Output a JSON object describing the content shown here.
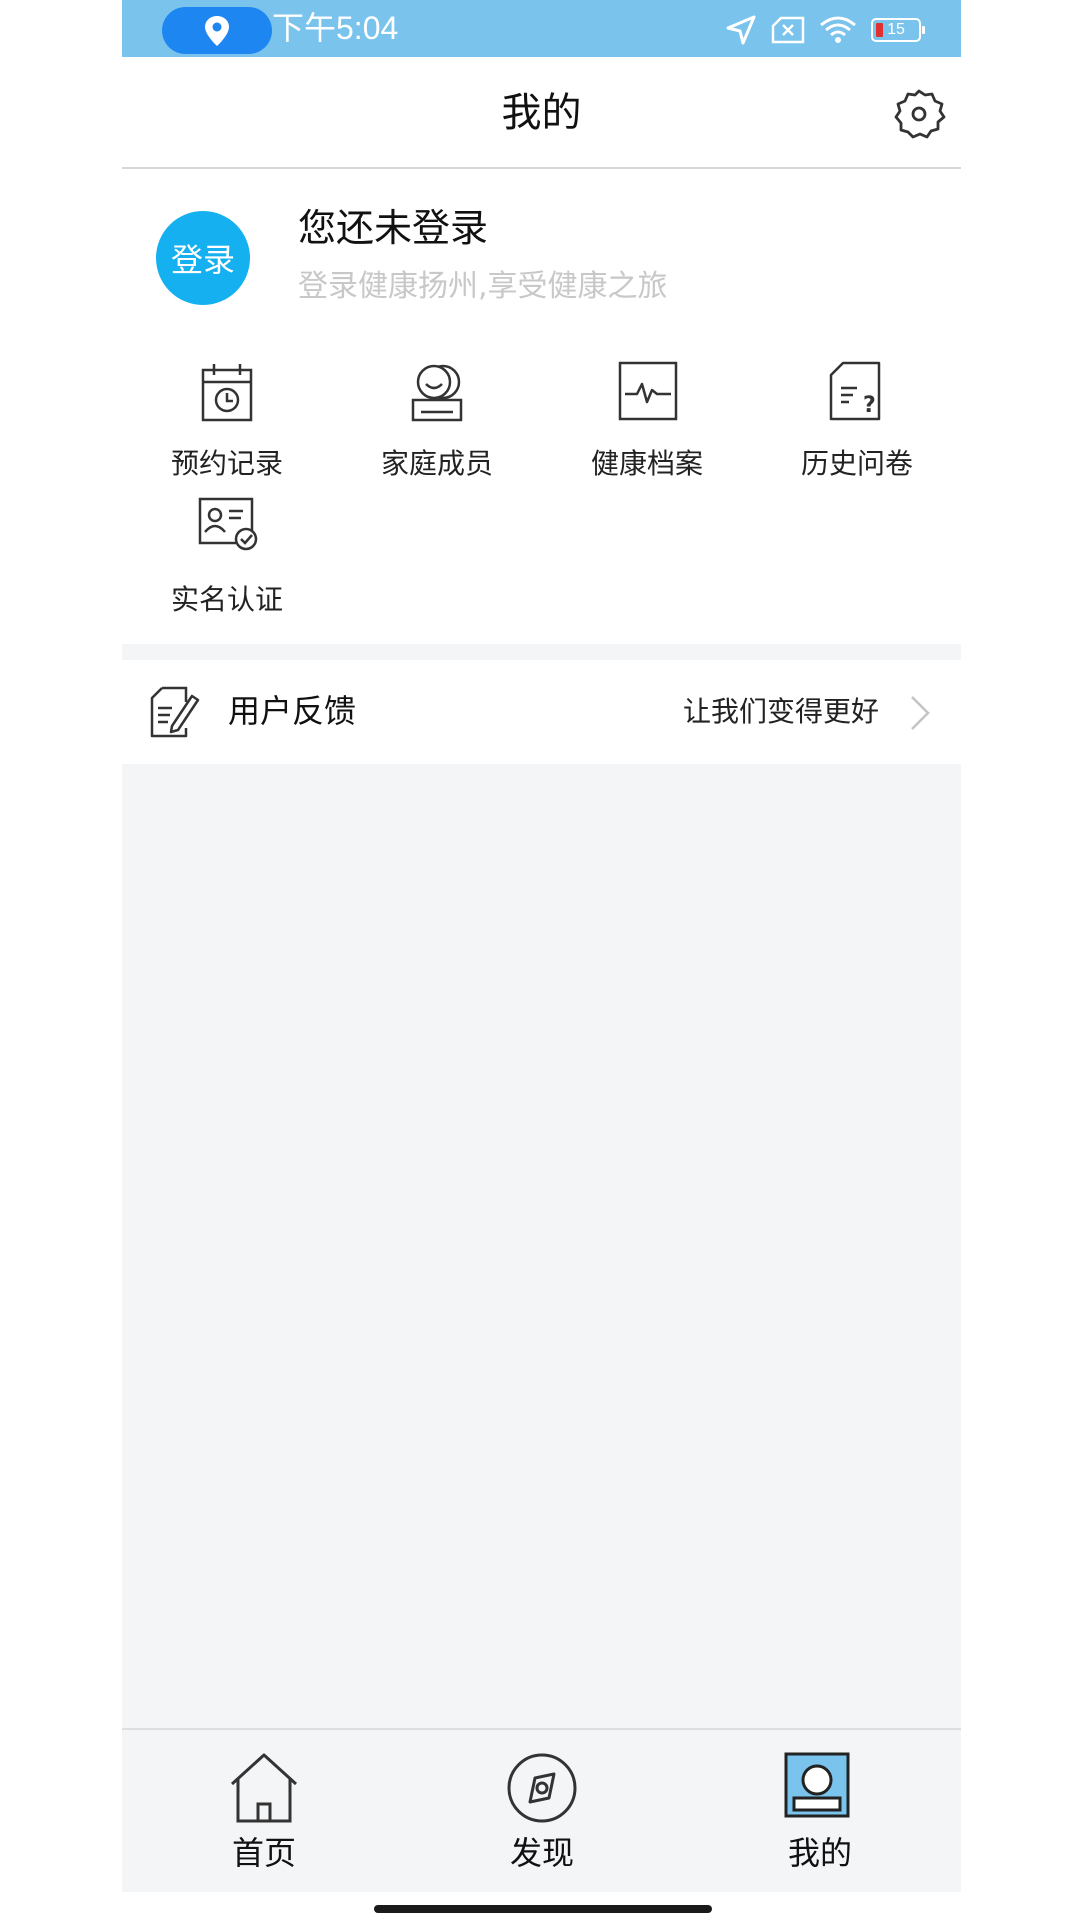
{
  "status_bar": {
    "time": "下午5:04",
    "battery": "15",
    "icons": [
      "location-pin-icon",
      "location-arrow-icon",
      "no-sim-icon",
      "wifi-icon",
      "battery-icon"
    ]
  },
  "header": {
    "title": "我的",
    "settings_icon": "gear-icon"
  },
  "profile": {
    "avatar_label": "登录",
    "title": "您还未登录",
    "subtitle": "登录健康扬州,享受健康之旅"
  },
  "functions": [
    {
      "label": "预约记录",
      "icon": "calendar-clock-icon"
    },
    {
      "label": "家庭成员",
      "icon": "family-members-icon"
    },
    {
      "label": "健康档案",
      "icon": "health-record-icon"
    },
    {
      "label": "历史问卷",
      "icon": "questionnaire-icon"
    },
    {
      "label": "实名认证",
      "icon": "id-verify-icon"
    }
  ],
  "feedback": {
    "label": "用户反馈",
    "hint": "让我们变得更好",
    "icon": "feedback-edit-icon"
  },
  "tabs": [
    {
      "label": "首页",
      "icon": "home-icon"
    },
    {
      "label": "发现",
      "icon": "compass-icon"
    },
    {
      "label": "我的",
      "icon": "profile-icon",
      "active": true
    }
  ],
  "colors": {
    "status_bar": "#79c3ec",
    "location_pill": "#1e86f0",
    "avatar": "#15b0ef",
    "active_tab": "#79c3ec",
    "page_bg": "#f4f5f7"
  }
}
